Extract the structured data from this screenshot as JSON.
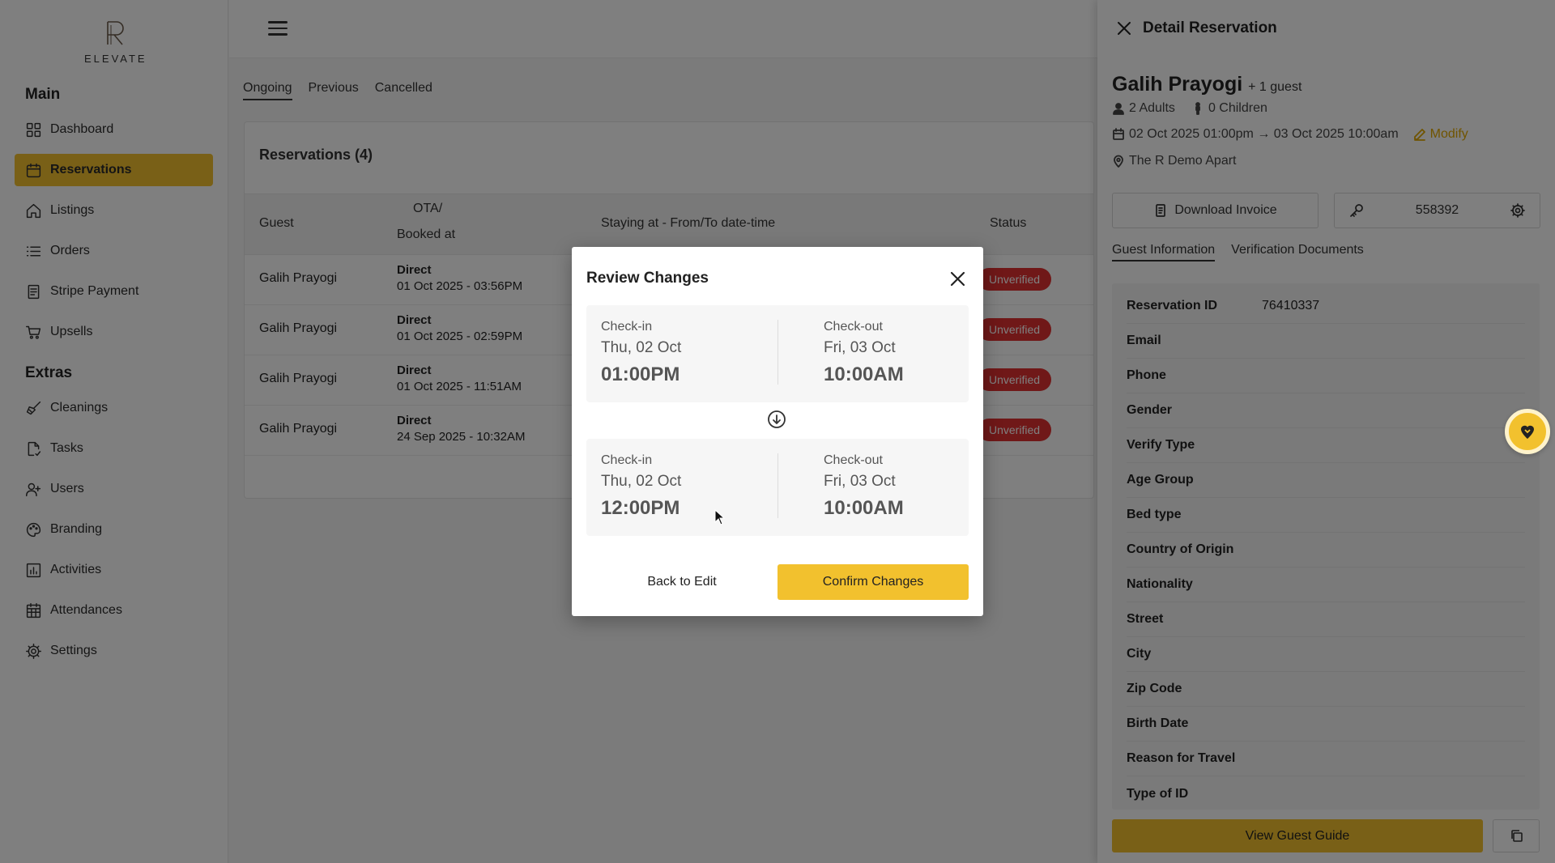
{
  "sidebar": {
    "logo_text": "ELEVATE",
    "section_main": "Main",
    "section_extras": "Extras",
    "main_items": [
      {
        "label": "Dashboard",
        "icon": "grid-icon"
      },
      {
        "label": "Reservations",
        "icon": "calendar-icon"
      },
      {
        "label": "Listings",
        "icon": "home-icon"
      },
      {
        "label": "Orders",
        "icon": "list-icon"
      },
      {
        "label": "Stripe Payment",
        "icon": "receipt-icon"
      },
      {
        "label": "Upsells",
        "icon": "cart-icon"
      }
    ],
    "extra_items": [
      {
        "label": "Cleanings",
        "icon": "broom-icon"
      },
      {
        "label": "Tasks",
        "icon": "task-icon"
      },
      {
        "label": "Users",
        "icon": "users-icon"
      },
      {
        "label": "Branding",
        "icon": "palette-icon"
      },
      {
        "label": "Activities",
        "icon": "bar-chart-icon"
      },
      {
        "label": "Attendances",
        "icon": "table-icon"
      },
      {
        "label": "Settings",
        "icon": "gear-icon"
      }
    ]
  },
  "tabs": [
    "Ongoing",
    "Previous",
    "Cancelled"
  ],
  "reservations": {
    "title": "Reservations (4)",
    "headers": {
      "guest": "Guest",
      "ota_line1": "OTA/",
      "ota_line2": "Booked at",
      "staying": "Staying at - From/To date-time",
      "status": "Status"
    },
    "rows": [
      {
        "guest": "Galih Prayogi",
        "ota": "Direct",
        "booked": "01 Oct 2025 - 03:56PM",
        "status": "Unverified"
      },
      {
        "guest": "Galih Prayogi",
        "ota": "Direct",
        "booked": "01 Oct 2025 - 02:59PM",
        "status": "Unverified"
      },
      {
        "guest": "Galih Prayogi",
        "ota": "Direct",
        "booked": "01 Oct 2025 - 11:51AM",
        "status": "Unverified"
      },
      {
        "guest": "Galih Prayogi",
        "ota": "Direct",
        "booked": "24 Sep 2025 - 10:32AM",
        "status": "Unverified"
      }
    ]
  },
  "drawer": {
    "title": "Detail Reservation",
    "guest_name": "Galih Prayogi",
    "guest_extra": "+ 1 guest",
    "adults": "2 Adults",
    "children": "0 Children",
    "dates": "02 Oct 2025 01:00pm → 03 Oct 2025 10:00am",
    "modify": "Modify",
    "location": "The R Demo Apart",
    "download_invoice": "Download Invoice",
    "door_code": "558392",
    "tab_guest_info": "Guest Information",
    "tab_verification": "Verification Documents",
    "fields": [
      {
        "key": "Reservation ID",
        "value": "76410337"
      },
      {
        "key": "Email",
        "value": ""
      },
      {
        "key": "Phone",
        "value": ""
      },
      {
        "key": "Gender",
        "value": ""
      },
      {
        "key": "Verify Type",
        "value": ""
      },
      {
        "key": "Age Group",
        "value": ""
      },
      {
        "key": "Bed type",
        "value": ""
      },
      {
        "key": "Country of Origin",
        "value": ""
      },
      {
        "key": "Nationality",
        "value": ""
      },
      {
        "key": "Street",
        "value": ""
      },
      {
        "key": "City",
        "value": ""
      },
      {
        "key": "Zip Code",
        "value": ""
      },
      {
        "key": "Birth Date",
        "value": ""
      },
      {
        "key": "Reason for Travel",
        "value": ""
      },
      {
        "key": "Type of ID",
        "value": ""
      }
    ],
    "view_guest_guide": "View Guest Guide"
  },
  "modal": {
    "title": "Review Changes",
    "before": {
      "checkin_label": "Check-in",
      "checkin_date": "Thu, 02 Oct",
      "checkin_time": "01:00PM",
      "checkout_label": "Check-out",
      "checkout_date": "Fri, 03 Oct",
      "checkout_time": "10:00AM"
    },
    "after": {
      "checkin_label": "Check-in",
      "checkin_date": "Thu, 02 Oct",
      "checkin_time": "12:00PM",
      "checkout_label": "Check-out",
      "checkout_date": "Fri, 03 Oct",
      "checkout_time": "10:00AM"
    },
    "back_label": "Back to Edit",
    "confirm_label": "Confirm Changes"
  },
  "colors": {
    "accent": "#f2c12e",
    "status_red": "#e03131",
    "modify": "#e0a800"
  }
}
